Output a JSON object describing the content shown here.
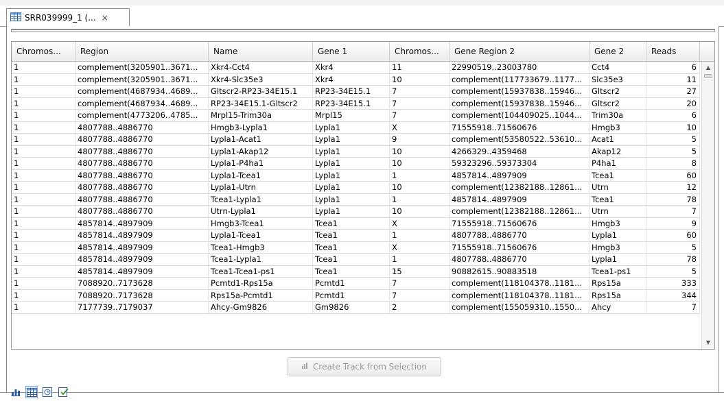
{
  "tab": {
    "title": "SRR039999_1 (...",
    "close": "×"
  },
  "columns": [
    "Chromos...",
    "Region",
    "Name",
    "Gene 1",
    "Chromos...",
    "Gene Region 2",
    "Gene 2",
    "Reads"
  ],
  "rows": [
    [
      "1",
      "complement(3205901..3671...",
      "Xkr4-Cct4",
      "Xkr4",
      "11",
      "22990519..23003780",
      "Cct4",
      "6"
    ],
    [
      "1",
      "complement(3205901..3671...",
      "Xkr4-Slc35e3",
      "Xkr4",
      "10",
      "complement(117733679..1177...",
      "Slc35e3",
      "11"
    ],
    [
      "1",
      "complement(4687934..4689...",
      "Gltscr2-RP23-34E15.1",
      "RP23-34E15.1",
      "7",
      "complement(15937838..15946...",
      "Gltscr2",
      "27"
    ],
    [
      "1",
      "complement(4687934..4689...",
      "RP23-34E15.1-Gltscr2",
      "RP23-34E15.1",
      "7",
      "complement(15937838..15946...",
      "Gltscr2",
      "20"
    ],
    [
      "1",
      "complement(4773206..4785...",
      "Mrpl15-Trim30a",
      "Mrpl15",
      "7",
      "complement(104409025..1044...",
      "Trim30a",
      "6"
    ],
    [
      "1",
      "4807788..4886770",
      "Hmgb3-Lypla1",
      "Lypla1",
      "X",
      "71555918..71560676",
      "Hmgb3",
      "10"
    ],
    [
      "1",
      "4807788..4886770",
      "Lypla1-Acat1",
      "Lypla1",
      "9",
      "complement(53580522..53610...",
      "Acat1",
      "5"
    ],
    [
      "1",
      "4807788..4886770",
      "Lypla1-Akap12",
      "Lypla1",
      "10",
      "4266329..4359468",
      "Akap12",
      "5"
    ],
    [
      "1",
      "4807788..4886770",
      "Lypla1-P4ha1",
      "Lypla1",
      "10",
      "59323296..59373304",
      "P4ha1",
      "8"
    ],
    [
      "1",
      "4807788..4886770",
      "Lypla1-Tcea1",
      "Lypla1",
      "1",
      "4857814..4897909",
      "Tcea1",
      "60"
    ],
    [
      "1",
      "4807788..4886770",
      "Lypla1-Utrn",
      "Lypla1",
      "10",
      "complement(12382188..12861...",
      "Utrn",
      "12"
    ],
    [
      "1",
      "4807788..4886770",
      "Tcea1-Lypla1",
      "Lypla1",
      "1",
      "4857814..4897909",
      "Tcea1",
      "78"
    ],
    [
      "1",
      "4807788..4886770",
      "Utrn-Lypla1",
      "Lypla1",
      "10",
      "complement(12382188..12861...",
      "Utrn",
      "7"
    ],
    [
      "1",
      "4857814..4897909",
      "Hmgb3-Tcea1",
      "Tcea1",
      "X",
      "71555918..71560676",
      "Hmgb3",
      "9"
    ],
    [
      "1",
      "4857814..4897909",
      "Lypla1-Tcea1",
      "Tcea1",
      "1",
      "4807788..4886770",
      "Lypla1",
      "60"
    ],
    [
      "1",
      "4857814..4897909",
      "Tcea1-Hmgb3",
      "Tcea1",
      "X",
      "71555918..71560676",
      "Hmgb3",
      "5"
    ],
    [
      "1",
      "4857814..4897909",
      "Tcea1-Lypla1",
      "Tcea1",
      "1",
      "4807788..4886770",
      "Lypla1",
      "78"
    ],
    [
      "1",
      "4857814..4897909",
      "Tcea1-Tcea1-ps1",
      "Tcea1",
      "15",
      "90882615..90883518",
      "Tcea1-ps1",
      "5"
    ],
    [
      "1",
      "7088920..7173628",
      "Pcmtd1-Rps15a",
      "Pcmtd1",
      "7",
      "complement(118104378..1181...",
      "Rps15a",
      "333"
    ],
    [
      "1",
      "7088920..7173628",
      "Rps15a-Pcmtd1",
      "Pcmtd1",
      "7",
      "complement(118104378..1181...",
      "Rps15a",
      "344"
    ],
    [
      "1",
      "7177739..7179037",
      "Ahcy-Gm9826",
      "Gm9826",
      "2",
      "complement(155059310..1550...",
      "Ahcy",
      "7"
    ]
  ],
  "create_track_button": "Create Track from Selection",
  "bottom_views": [
    "graph-view-icon",
    "table-view-icon",
    "history-view-icon",
    "annotation-view-icon"
  ],
  "colors": {
    "accent": "#2b5fa8",
    "grid": "#dcdcdc"
  }
}
